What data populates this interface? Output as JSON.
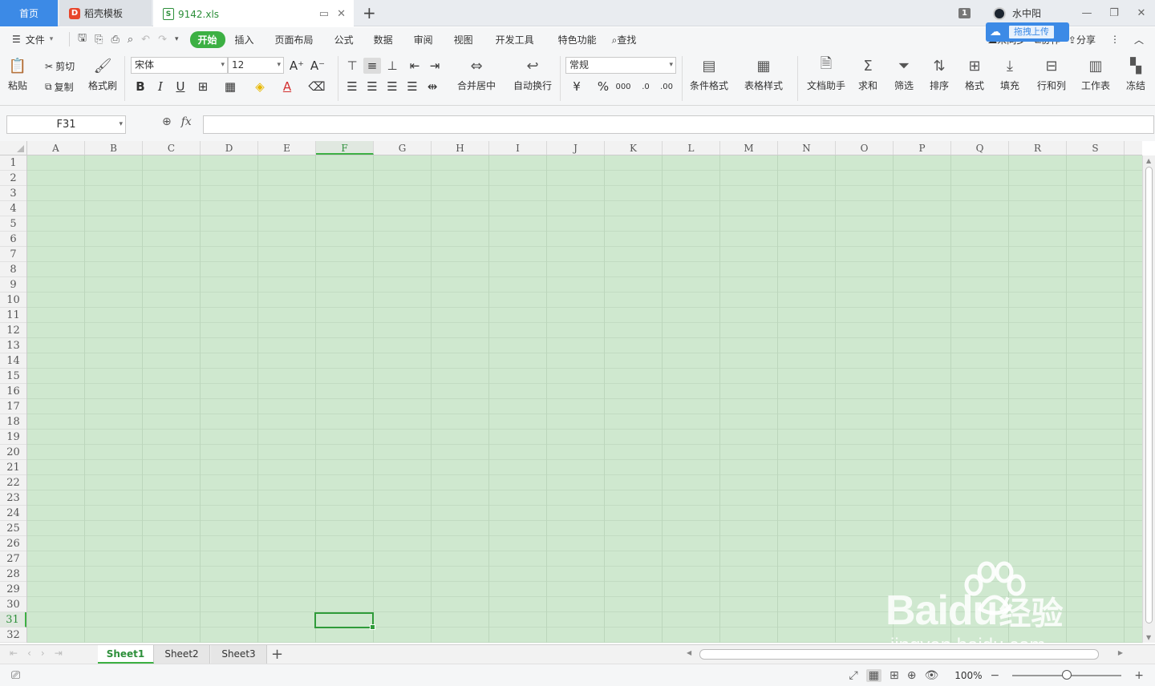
{
  "tabs": {
    "home": "首页",
    "docer": "稻壳模板",
    "file": "9142.xls"
  },
  "titlebar": {
    "window_count": "1",
    "user_name": "水中阳",
    "upload_tip": "拖拽上传"
  },
  "menu": {
    "file": "文件",
    "items": [
      "开始",
      "插入",
      "页面布局",
      "公式",
      "数据",
      "审阅",
      "视图",
      "开发工具",
      "特色功能"
    ],
    "search": "查找",
    "sync_status": "未同步",
    "collab": "协作",
    "share": "分享"
  },
  "ribbon": {
    "paste": "粘贴",
    "cut": "剪切",
    "copy": "复制",
    "format_painter": "格式刷",
    "font_name": "宋体",
    "font_size": "12",
    "merge_center": "合并居中",
    "wrap_text": "自动换行",
    "number_format": "常规",
    "cond_format": "条件格式",
    "table_style": "表格样式",
    "doc_assistant": "文档助手",
    "sum": "求和",
    "filter": "筛选",
    "sort": "排序",
    "format": "格式",
    "fill": "填充",
    "row_col": "行和列",
    "worksheet": "工作表",
    "freeze": "冻结"
  },
  "formula_bar": {
    "cell_ref": "F31",
    "fx": "fx",
    "value": ""
  },
  "grid": {
    "columns": [
      "A",
      "B",
      "C",
      "D",
      "E",
      "F",
      "G",
      "H",
      "I",
      "J",
      "K",
      "L",
      "M",
      "N",
      "O",
      "P",
      "Q",
      "R",
      "S"
    ],
    "active_column": "F",
    "rows": [
      "1",
      "2",
      "3",
      "4",
      "5",
      "6",
      "7",
      "8",
      "9",
      "10",
      "11",
      "12",
      "13",
      "14",
      "15",
      "16",
      "17",
      "18",
      "19",
      "20",
      "21",
      "22",
      "23",
      "24",
      "25",
      "26",
      "27",
      "28",
      "29",
      "30",
      "31",
      "32"
    ],
    "active_row": "31"
  },
  "sheets": [
    "Sheet1",
    "Sheet2",
    "Sheet3"
  ],
  "active_sheet": "Sheet1",
  "status": {
    "zoom": "100%"
  },
  "colors": {
    "accent": "#3cb043",
    "tab_blue": "#3c8ae6",
    "cell_bg": "#cfe8cf"
  }
}
